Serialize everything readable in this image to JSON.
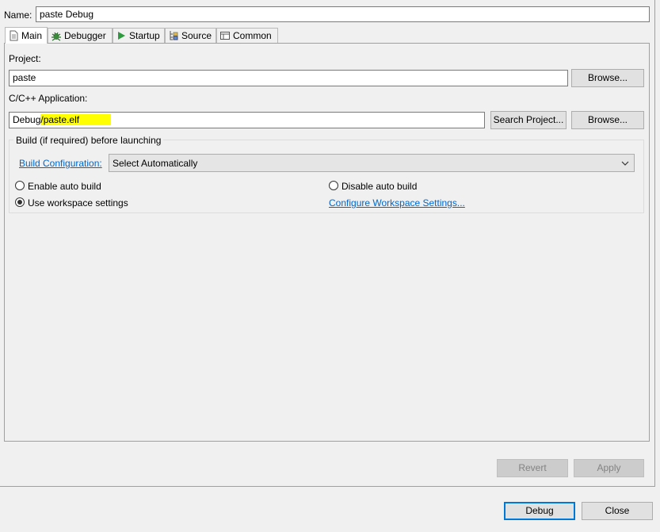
{
  "name_label": "Name:",
  "name_value": "paste Debug",
  "tabs": [
    {
      "label": "Main",
      "icon": "main-tab-icon"
    },
    {
      "label": "Debugger",
      "icon": "debugger-tab-icon"
    },
    {
      "label": "Startup",
      "icon": "startup-tab-icon"
    },
    {
      "label": "Source",
      "icon": "source-tab-icon"
    },
    {
      "label": "Common",
      "icon": "common-tab-icon"
    }
  ],
  "project": {
    "label": "Project:",
    "value": "paste",
    "browse_label": "Browse..."
  },
  "application": {
    "label": "C/C++ Application:",
    "value_prefix": "Debug",
    "value_highlight": "/paste.elf",
    "search_label": "Search Project...",
    "browse_label": "Browse...",
    "highlight_color": "#ffff00"
  },
  "build": {
    "group_label": "Build (if required) before launching",
    "config_link": "Build Configuration:",
    "config_value": "Select Automatically",
    "enable_auto": "Enable auto build",
    "disable_auto": "Disable auto build",
    "use_workspace": "Use workspace settings",
    "configure_link": "Configure Workspace Settings...",
    "selected": "use_workspace"
  },
  "buttons": {
    "revert": "Revert",
    "apply": "Apply",
    "debug": "Debug",
    "close": "Close"
  },
  "colors": {
    "link": "#0066cc",
    "accent": "#0078d7"
  }
}
